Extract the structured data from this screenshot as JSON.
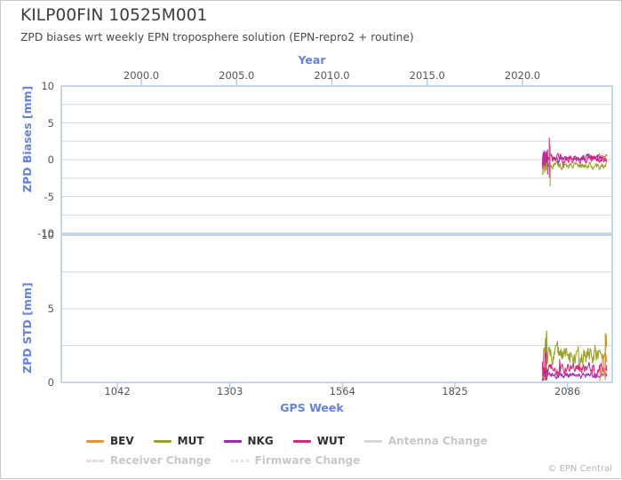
{
  "header": {
    "title": "KILP00FIN 10525M001",
    "subtitle": "ZPD biases wrt weekly EPN troposphere solution (EPN-repro2 + routine)"
  },
  "footer": {
    "credit": "© EPN Central"
  },
  "legend": {
    "items": [
      {
        "label": "BEV",
        "color": "#e8932c",
        "style": "solid",
        "muted": false
      },
      {
        "label": "MUT",
        "color": "#9aa021",
        "style": "solid",
        "muted": false
      },
      {
        "label": "NKG",
        "color": "#9c27b0",
        "style": "solid",
        "muted": false
      },
      {
        "label": "WUT",
        "color": "#d6277f",
        "style": "solid",
        "muted": false
      },
      {
        "label": "Antenna Change",
        "color": "#d8d8d8",
        "style": "solid",
        "muted": true
      },
      {
        "label": "Receiver Change",
        "color": "#e0e0e0",
        "style": "dashed",
        "muted": true
      },
      {
        "label": "Firmware Change",
        "color": "#e4e4e4",
        "style": "dotted",
        "muted": true
      }
    ]
  },
  "chart_data": {
    "type": "line",
    "title": "KILP00FIN 10525M001",
    "subtitle": "ZPD biases wrt weekly EPN troposphere solution (EPN-repro2 + routine)",
    "grid": true,
    "legend_position": "bottom",
    "x_axis_bottom": {
      "label": "GPS Week",
      "ticks": [
        1042,
        1303,
        1564,
        1825,
        2086
      ],
      "tick_labels": [
        "1042",
        "1303",
        "1564",
        "1825",
        "2086"
      ],
      "xlim": [
        912,
        2190
      ]
    },
    "x_axis_top": {
      "label": "Year",
      "ticks": [
        2000.0,
        2005.0,
        2010.0,
        2015.0,
        2020.0
      ],
      "tick_labels": [
        "2000.0",
        "2005.0",
        "2010.0",
        "2015.0",
        "2020.0"
      ],
      "xlim": [
        1997.4,
        2021.9
      ]
    },
    "panels": [
      {
        "name": "zpd-biases",
        "ylabel": "ZPD Biases [mm]",
        "ylim": [
          -10,
          10
        ],
        "yticks": [
          -10,
          -5,
          0,
          5,
          10
        ],
        "ytick_labels": [
          "-10",
          "-5",
          "0",
          "5",
          "10"
        ],
        "gridline_step": 2.5,
        "data_span_gps_week": [
          2028,
          2177
        ],
        "series": [
          {
            "name": "BEV",
            "color": "#e8932c",
            "mean": 0.35,
            "noise": 0.22,
            "n": 12,
            "x_start": 2160,
            "x_end": 2177
          },
          {
            "name": "MUT",
            "color": "#9aa021",
            "mean": -0.85,
            "noise": 0.45,
            "n": 150,
            "x_start": 2028,
            "x_end": 2177
          },
          {
            "name": "NKG",
            "color": "#9c27b0",
            "mean": 0.3,
            "noise": 0.35,
            "n": 150,
            "x_start": 2028,
            "x_end": 2177
          },
          {
            "name": "WUT",
            "color": "#d6277f",
            "mean": 0.1,
            "noise": 0.55,
            "n": 150,
            "x_start": 2028,
            "x_end": 2177
          }
        ]
      },
      {
        "name": "zpd-std",
        "ylabel": "ZPD STD [mm]",
        "ylim": [
          0,
          10
        ],
        "yticks": [
          0,
          5,
          10
        ],
        "ytick_labels": [
          "0",
          "5",
          "10"
        ],
        "gridline_step": 2.5,
        "data_span_gps_week": [
          2028,
          2177
        ],
        "series": [
          {
            "name": "BEV",
            "color": "#e8932c",
            "mean": 1.4,
            "noise": 1.0,
            "n": 12,
            "x_start": 2160,
            "x_end": 2177
          },
          {
            "name": "MUT",
            "color": "#9aa021",
            "mean": 1.85,
            "noise": 0.55,
            "n": 150,
            "x_start": 2028,
            "x_end": 2177
          },
          {
            "name": "NKG",
            "color": "#9c27b0",
            "mean": 0.45,
            "noise": 0.18,
            "n": 150,
            "x_start": 2028,
            "x_end": 2177
          },
          {
            "name": "WUT",
            "color": "#d6277f",
            "mean": 0.95,
            "noise": 0.35,
            "n": 150,
            "x_start": 2028,
            "x_end": 2177
          }
        ]
      }
    ]
  }
}
